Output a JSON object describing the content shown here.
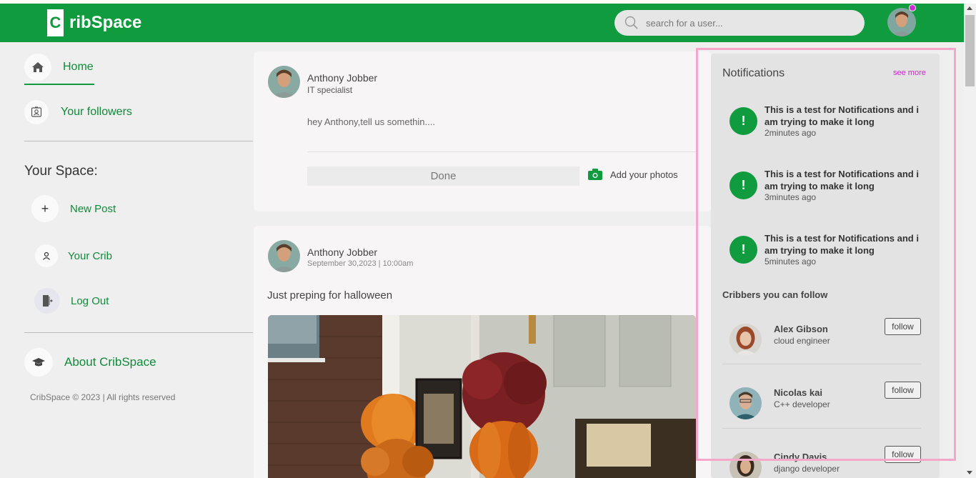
{
  "brand": {
    "logo_letter": "C",
    "logo_text": "ribSpace"
  },
  "search": {
    "placeholder": "search for a user..."
  },
  "colors": {
    "brand_green": "#0f9b3e",
    "notification_dot": "#d12ad6",
    "see_more": "#c928c9",
    "highlight_frame": "#f6a6c8"
  },
  "sidebar": {
    "nav": [
      {
        "label": "Home",
        "icon": "home-icon"
      },
      {
        "label": "Your followers",
        "icon": "contact-card-icon"
      }
    ],
    "space_title": "Your Space:",
    "space_items": [
      {
        "label": "New Post",
        "icon": "plus-icon"
      },
      {
        "label": "Your Crib",
        "icon": "user-icon"
      },
      {
        "label": "Log Out",
        "icon": "logout-icon"
      }
    ],
    "about": {
      "label": "About CribSpace",
      "icon": "graduation-cap-icon"
    },
    "copyright": "CribSpace © 2023 | All rights reserved"
  },
  "composer": {
    "name": "Anthony Jobber",
    "title": "IT specialist",
    "prompt": "hey Anthony,tell us somethin....",
    "done_label": "Done",
    "add_photos_label": "Add your photos"
  },
  "post": {
    "name": "Anthony Jobber",
    "date": "September 30,2023 | 10:00am",
    "text": "Just preping for halloween"
  },
  "notifications": {
    "title": "Notifications",
    "see_more": "see more",
    "items": [
      {
        "text": "This is a test for Notifications and i am trying to make it long",
        "time": "2minutes ago"
      },
      {
        "text": "This is a test for Notifications and i am trying to make it long",
        "time": "3minutes ago"
      },
      {
        "text": "This is a test for Notifications and i am trying to make it long",
        "time": "5minutes ago"
      }
    ],
    "follow_title": "Cribbers you can follow",
    "cribbers": [
      {
        "name": "Alex Gibson",
        "job": "cloud engineer",
        "button": "follow"
      },
      {
        "name": "Nicolas kai",
        "job": "C++ developer",
        "button": "follow"
      },
      {
        "name": "Cindy Davis",
        "job": "django developer",
        "button": "follow"
      }
    ]
  }
}
